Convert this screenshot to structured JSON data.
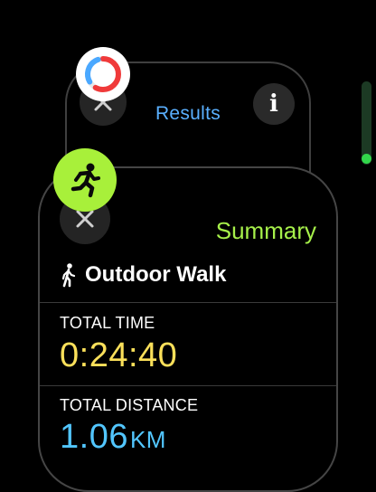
{
  "results_card": {
    "title": "Results",
    "info_label": "i"
  },
  "summary_card": {
    "title": "Summary",
    "workout_name": "Outdoor Walk",
    "stats": {
      "time": {
        "label": "TOTAL TIME",
        "value": "0:24:40"
      },
      "distance": {
        "label": "TOTAL DISTANCE",
        "value": "1.06",
        "unit": "KM"
      }
    }
  },
  "icons": {
    "close": "close-icon",
    "info": "info-icon",
    "activity_rings": "activity-rings-icon",
    "runner": "runner-icon",
    "walker": "walker-icon"
  },
  "colors": {
    "results_title": "#5ab0ff",
    "summary_title": "#a6f04a",
    "run_badge": "#a8f03a",
    "time_value": "#fbe05a",
    "distance_value": "#52c6ff",
    "scroll_thumb": "#32d74b"
  }
}
